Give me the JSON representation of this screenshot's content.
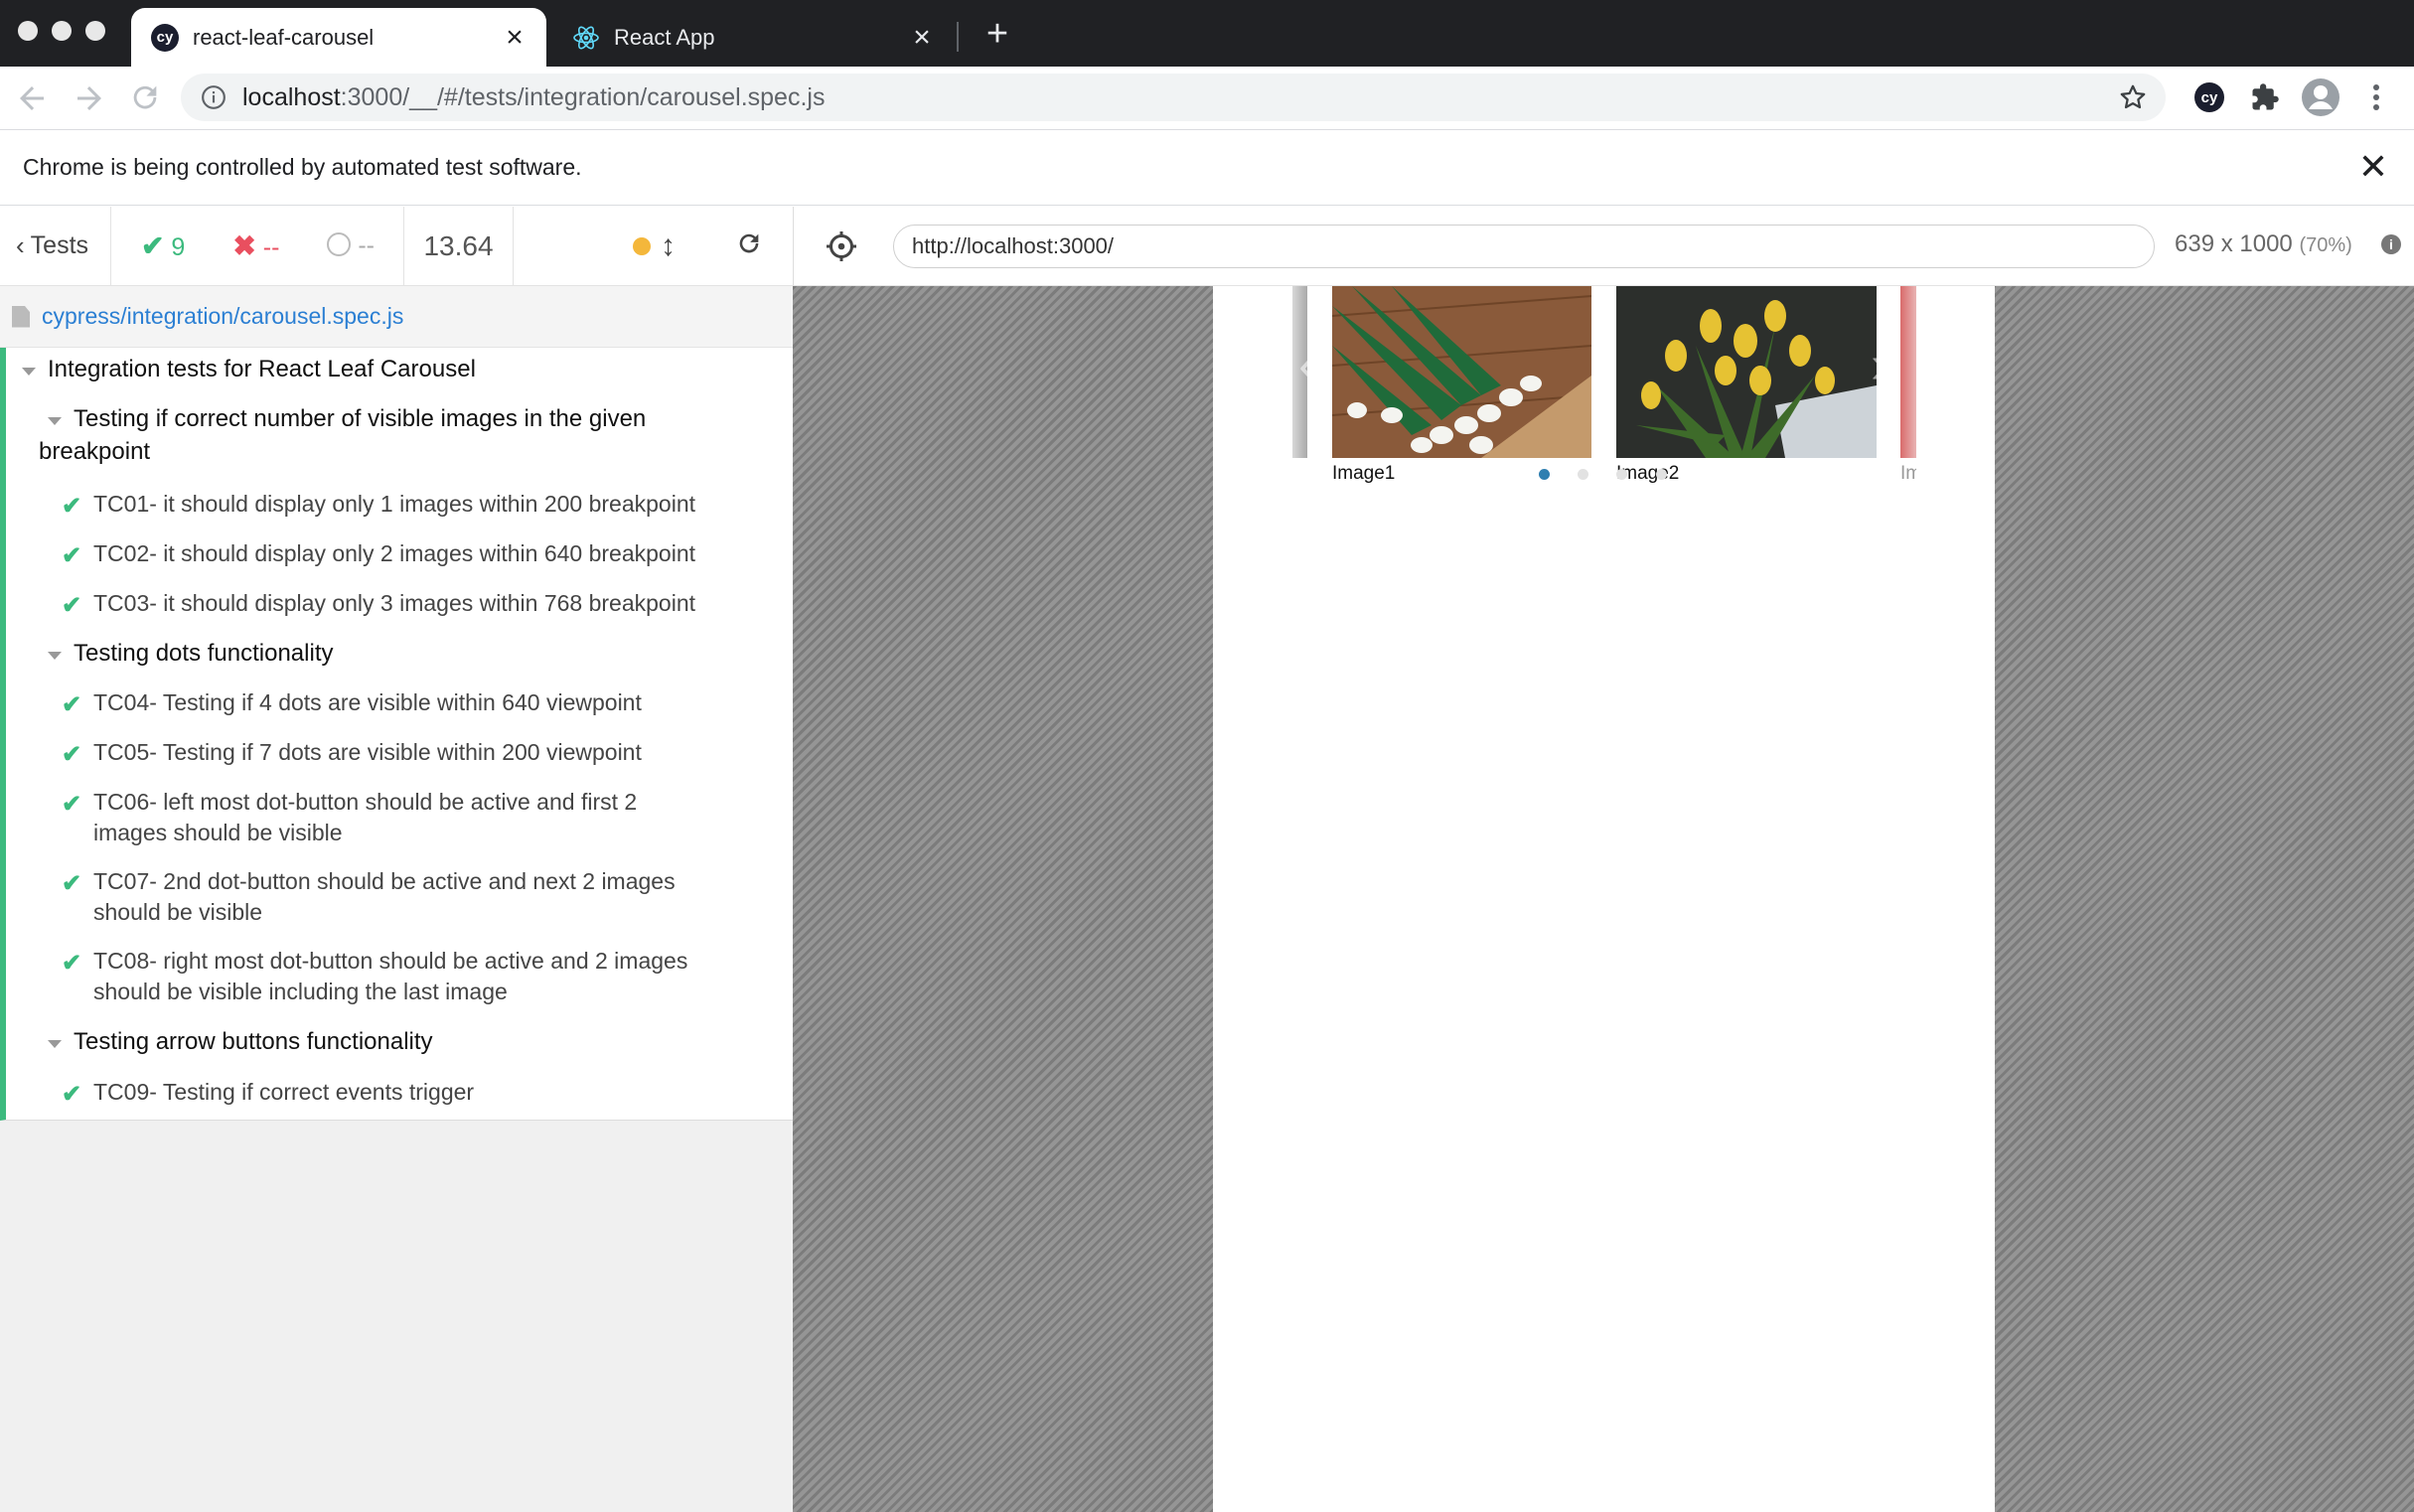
{
  "browser": {
    "tabs": [
      {
        "title": "react-leaf-carousel",
        "favicon": "cypress-icon",
        "active": true
      },
      {
        "title": "React App",
        "favicon": "react-icon",
        "active": false
      }
    ],
    "url_host": "localhost",
    "url_path": ":3000/__/#/tests/integration/carousel.spec.js",
    "infobar_message": "Chrome is being controlled by automated test software."
  },
  "reporter": {
    "tests_label": "Tests",
    "passed": "9",
    "failed": "--",
    "pending": "--",
    "duration": "13.64",
    "status_color": "#f4b73b",
    "spec_file": "cypress/integration/carousel.spec.js",
    "root_suite": "Integration tests for React Leaf Carousel",
    "suites": [
      {
        "title_line1": "Testing if correct number of visible images in the given",
        "title_line2": "breakpoint"
      },
      {
        "title_line1": "Testing dots functionality"
      },
      {
        "title_line1": "Testing arrow buttons functionality"
      }
    ],
    "tests": [
      {
        "line1": "TC01- it should display only 1 images within 200 breakpoint",
        "state": "passed"
      },
      {
        "line1": "TC02- it should display only 2 images within 640 breakpoint",
        "state": "passed"
      },
      {
        "line1": "TC03- it should display only 3 images within 768 breakpoint",
        "state": "passed"
      },
      {
        "line1": "TC04- Testing if 4 dots are visible within 640 viewpoint",
        "state": "passed"
      },
      {
        "line1": "TC05- Testing if 7 dots are visible within 200 viewpoint",
        "state": "passed"
      },
      {
        "line1": "TC06- left most dot-button should be active and first 2",
        "line2": "images should be visible",
        "state": "passed"
      },
      {
        "line1": "TC07- 2nd dot-button should be active and next 2 images",
        "line2": "should be visible",
        "state": "passed"
      },
      {
        "line1": "TC08- right most dot-button should be active and 2 images",
        "line2": "should be visible including the last image",
        "state": "passed"
      },
      {
        "line1": "TC09- Testing if correct events trigger",
        "state": "passed"
      }
    ],
    "colors": {
      "passed": "#3cba7e",
      "failed": "#e94f5f",
      "link": "#2b7fd3"
    }
  },
  "aut": {
    "url": "http://localhost:3000/",
    "viewport": "639 x 1000",
    "scale": "(70%)",
    "captions": [
      "Image1",
      "Image2",
      "Im"
    ],
    "active_dot_color": "#2f7fb0"
  }
}
